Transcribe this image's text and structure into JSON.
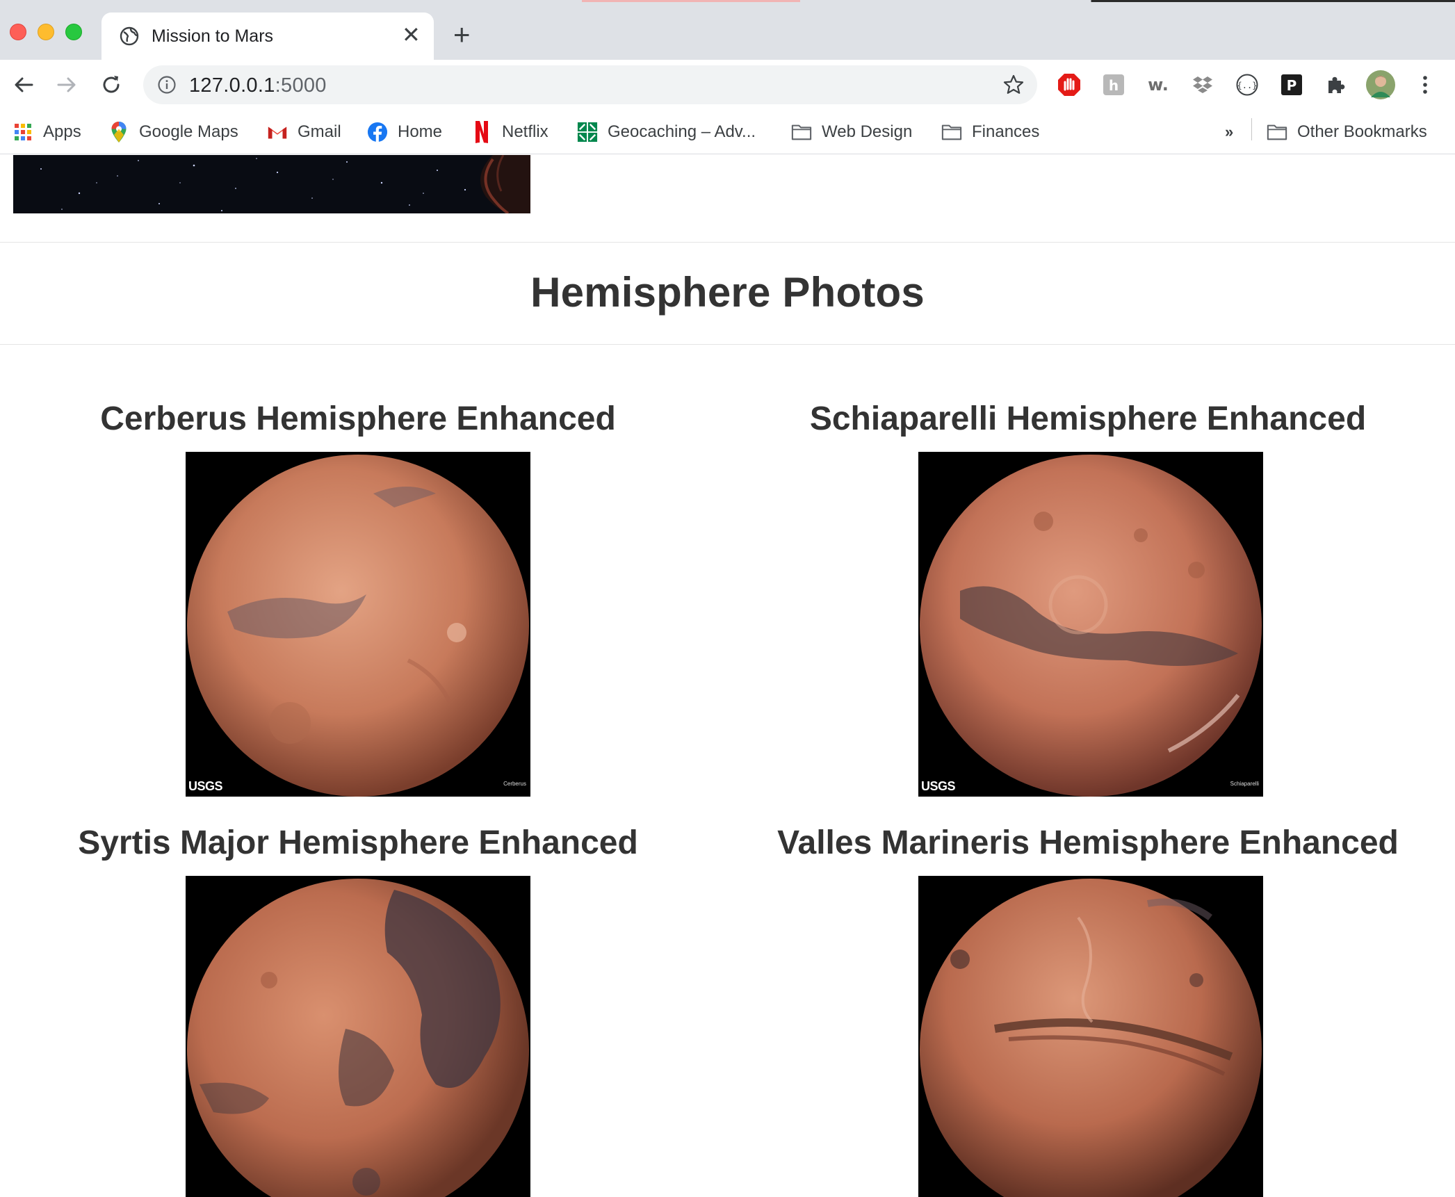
{
  "browser": {
    "tab_title": "Mission to Mars",
    "url_host": "127.0.0.1",
    "url_port": ":5000",
    "bookmarks": [
      {
        "label": "Apps",
        "icon": "apps-grid-icon"
      },
      {
        "label": "Google Maps",
        "icon": "google-maps-icon"
      },
      {
        "label": "Gmail",
        "icon": "gmail-icon"
      },
      {
        "label": "Home",
        "icon": "facebook-icon"
      },
      {
        "label": "Netflix",
        "icon": "netflix-icon"
      },
      {
        "label": "Geocaching – Adv...",
        "icon": "geocaching-icon"
      },
      {
        "label": "Web Design",
        "icon": "folder-icon"
      },
      {
        "label": "Finances",
        "icon": "folder-icon"
      }
    ],
    "overflow_label": "»",
    "other_bookmarks": "Other Bookmarks"
  },
  "page": {
    "section_title": "Hemisphere Photos",
    "hemispheres": [
      {
        "title": "Cerberus Hemisphere Enhanced",
        "caption": "Cerberus",
        "logo": "USGS"
      },
      {
        "title": "Schiaparelli Hemisphere Enhanced",
        "caption": "Schiaparelli",
        "logo": "USGS"
      },
      {
        "title": "Syrtis Major Hemisphere Enhanced",
        "caption": "",
        "logo": ""
      },
      {
        "title": "Valles Marineris Hemisphere Enhanced",
        "caption": "",
        "logo": ""
      }
    ]
  },
  "colors": {
    "mars_light": "#d48a6a",
    "mars_mid": "#b8654a",
    "mars_dark": "#5a3a36"
  }
}
